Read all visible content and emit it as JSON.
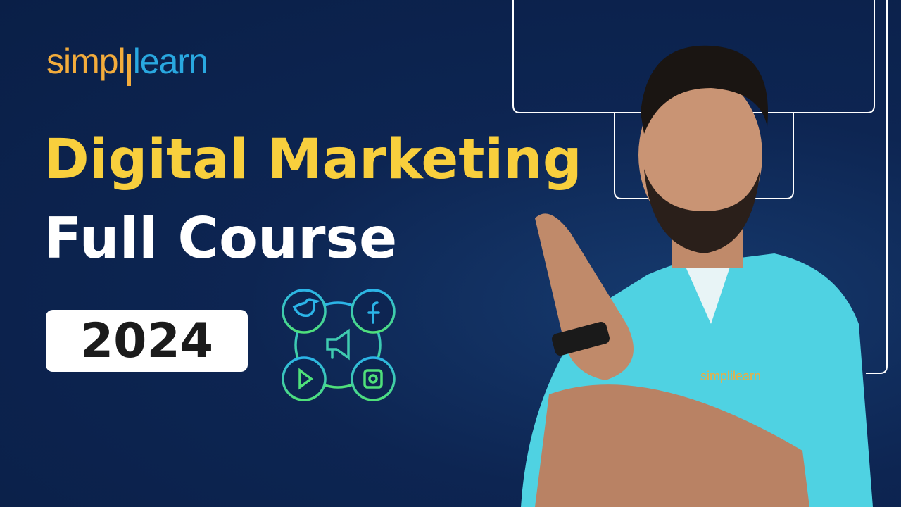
{
  "logo": {
    "part1": "simpl",
    "part2": "learn"
  },
  "title": {
    "line1": "Digital Marketing",
    "line2": "Full Course"
  },
  "year": "2024",
  "shirt_logo": "simplilearn",
  "colors": {
    "background": "#0d2552",
    "title_yellow": "#f8cf3d",
    "logo_orange": "#f3ac3c",
    "logo_blue": "#29a8e0",
    "shirt": "#4fd2e2"
  },
  "icons": [
    "twitter-icon",
    "facebook-icon",
    "megaphone-icon",
    "youtube-play-icon",
    "instagram-icon"
  ]
}
